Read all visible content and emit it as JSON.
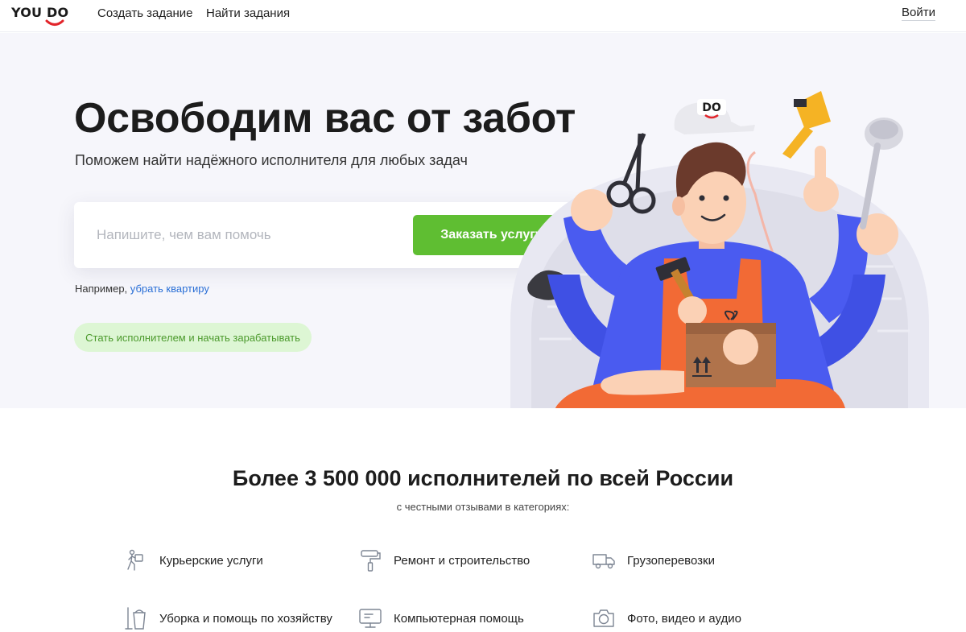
{
  "header": {
    "logo_text": "YOU DO",
    "nav": {
      "create_task": "Создать задание",
      "find_tasks": "Найти задания"
    },
    "login": "Войти"
  },
  "hero": {
    "title": "Освободим вас от забот",
    "subtitle": "Поможем найти надёжного исполнителя для любых задач",
    "search_placeholder": "Напишите, чем вам помочь",
    "search_value": "",
    "order_button": "Заказать услугу",
    "example_prefix": "Например,",
    "example_link": "убрать квартиру",
    "become_button": "Стать исполнителем и начать зарабатывать",
    "illustration_cap_text": "DO"
  },
  "stats": {
    "title": "Более 3 500 000 исполнителей по всей России",
    "subtitle": "с честными отзывами в категориях:"
  },
  "categories": [
    {
      "label": "Курьерские услуги",
      "icon": "courier-icon"
    },
    {
      "label": "Ремонт и строительство",
      "icon": "paint-roller-icon"
    },
    {
      "label": "Грузоперевозки",
      "icon": "truck-icon"
    },
    {
      "label": "Уборка и помощь по хозяйству",
      "icon": "bucket-icon"
    },
    {
      "label": "Компьютерная помощь",
      "icon": "monitor-icon"
    },
    {
      "label": "Фото, видео и аудио",
      "icon": "camera-icon"
    }
  ],
  "colors": {
    "accent_green": "#5fbe32",
    "accent_green_light": "#ddf6d4",
    "link_blue": "#2a6fd6",
    "hero_bg": "#f6f6fb",
    "logo_red": "#e2252b"
  }
}
